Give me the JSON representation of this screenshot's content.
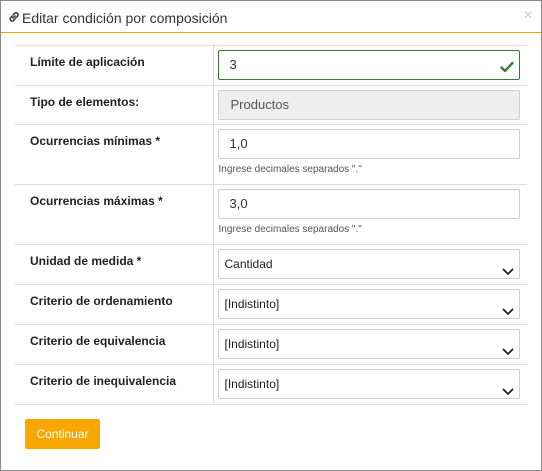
{
  "dialog": {
    "title": "Editar condición por composición",
    "close_symbol": "×",
    "title_icon": "link-icon"
  },
  "fields": {
    "limite": {
      "label": "Límite de aplicación",
      "value": "3",
      "status": "valid"
    },
    "tipo": {
      "label": "Tipo de elementos:",
      "value": "Productos"
    },
    "ocurrencias_min": {
      "label": "Ocurrencias mínimas *",
      "value": "1,0",
      "hint": "Ingrese decimales separados \".\""
    },
    "ocurrencias_max": {
      "label": "Ocurrencias máximas *",
      "value": "3,0",
      "hint": "Ingrese decimales separados \".\""
    },
    "unidad": {
      "label": "Unidad de medida *",
      "selected": "Cantidad"
    },
    "ordenamiento": {
      "label": "Criterio de ordenamiento",
      "selected": "[Indistinto]"
    },
    "equivalencia": {
      "label": "Criterio de equivalencia",
      "selected": "[Indistinto]"
    },
    "inequivalencia": {
      "label": "Criterio de inequivalencia",
      "selected": "[Indistinto]"
    }
  },
  "actions": {
    "continue_label": "Continuar"
  },
  "colors": {
    "accent": "#f7a700",
    "valid": "#3c7a3c",
    "border": "#dddddd"
  }
}
